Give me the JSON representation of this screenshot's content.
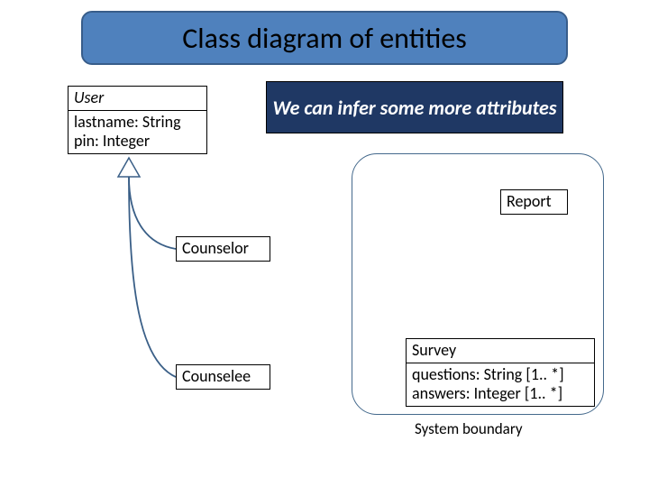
{
  "title": "Class diagram of entities",
  "callout": "We can infer some more attributes",
  "user": {
    "name": "User",
    "attr1": "lastname: String",
    "attr2": "pin: Integer"
  },
  "counselor": {
    "name": "Counselor"
  },
  "counselee": {
    "name": "Counselee"
  },
  "report": {
    "name": "Report"
  },
  "survey": {
    "name": "Survey",
    "attr1": "questions: String [1.. *]",
    "attr2": "answers: Integer [1.. *]"
  },
  "boundary_label": "System boundary"
}
